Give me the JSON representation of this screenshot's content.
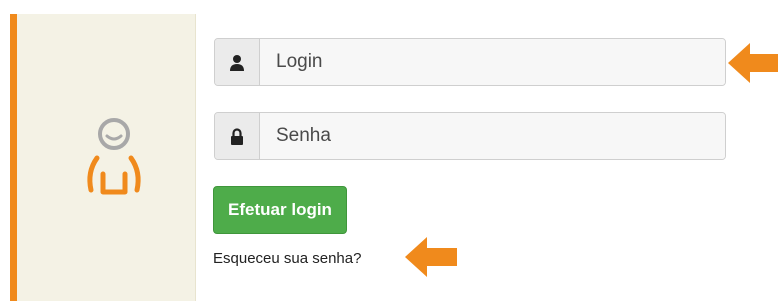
{
  "colors": {
    "accent": "#f08a1c",
    "login_button": "#4eac4a",
    "left_pane": "#f4f2e5",
    "user_icon": "#f08a1c",
    "user_face": "#a8a8a8"
  },
  "login_field": {
    "icon": "user-icon",
    "placeholder": "Login"
  },
  "password_field": {
    "icon": "lock-icon",
    "placeholder": "Senha"
  },
  "actions": {
    "login_button_label": "Efetuar login",
    "forgot_password_label": "Esqueceu sua senha?"
  },
  "annotations": {
    "arrow_icon": "arrow-left-icon"
  }
}
